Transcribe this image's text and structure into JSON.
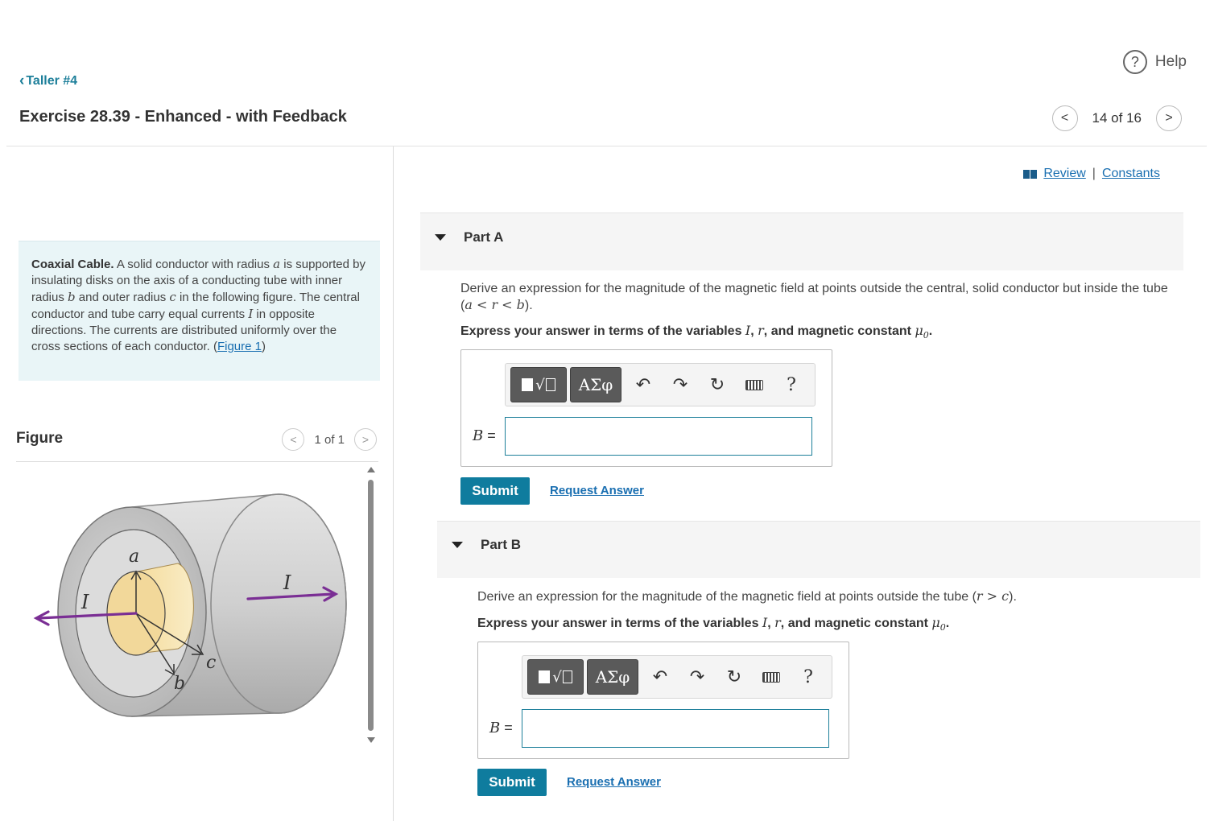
{
  "nav": {
    "back_label": "Taller #4"
  },
  "header": {
    "title": "Exercise 28.39 - Enhanced - with Feedback",
    "help_icon": "?",
    "help_label": "Help",
    "pager": {
      "prev": "<",
      "count": "14 of 16",
      "next": ">"
    }
  },
  "intro": {
    "heading": "Coaxial Cable.",
    "t1": " A solid conductor with radius ",
    "v_a": "a",
    "t2": " is supported by insulating disks on the axis of a conducting tube with inner radius ",
    "v_b": "b",
    "t3": " and outer radius ",
    "v_c": "c",
    "t4": " in the following figure. The central conductor and tube carry equal currents ",
    "v_I": "I",
    "t5": " in opposite directions. The currents are distributed uniformly over the cross sections of each conductor. (",
    "figure_link": "Figure 1",
    "t6": ")"
  },
  "figure": {
    "title": "Figure",
    "count": "1 of 1",
    "prev": "<",
    "next": ">",
    "labels": {
      "a": "a",
      "b": "b",
      "c": "c",
      "I_left": "I",
      "I_right": "I"
    }
  },
  "links": {
    "review": "Review",
    "sep": "|",
    "constants": "Constants"
  },
  "partA": {
    "label": "Part A",
    "prompt_main": "Derive an expression for the magnitude of the magnetic field at points outside the central, solid conductor but inside the tube",
    "prompt_open": "(",
    "prompt_math": "a < r < b",
    "prompt_close": ").",
    "express_pre": "Express your answer in terms of the variables ",
    "var_I": "I",
    "comma1": ", ",
    "var_r": "r",
    "express_mid": ", and magnetic constant ",
    "var_mu": "μ",
    "var_mu_sub": "0",
    "express_end": ".",
    "answer_label": "B",
    "equals": " =",
    "answer_value": "",
    "submit": "Submit",
    "request": "Request Answer"
  },
  "partB": {
    "label": "Part B",
    "prompt_main": "Derive an expression for the magnitude of the magnetic field at points outside the tube ",
    "prompt_open": "(",
    "prompt_math": "r > c",
    "prompt_close": ").",
    "express_pre": "Express your answer in terms of the variables ",
    "var_I": "I",
    "comma1": ", ",
    "var_r": "r",
    "express_mid": ", and magnetic constant ",
    "var_mu": "μ",
    "var_mu_sub": "0",
    "express_end": ".",
    "answer_label": "B",
    "equals": " =",
    "answer_value": "",
    "submit": "Submit",
    "request": "Request Answer"
  },
  "toolbar": {
    "radical": "√",
    "greek": "ΑΣφ",
    "undo": "↶",
    "redo": "↷",
    "reset": "↻",
    "help": "?"
  },
  "colors": {
    "accent": "#0f7c9e",
    "link": "#1a6fb1",
    "intro_bg": "#e9f5f7",
    "arrow_purple": "#7a2e94",
    "core_fill": "#f2d89a"
  }
}
